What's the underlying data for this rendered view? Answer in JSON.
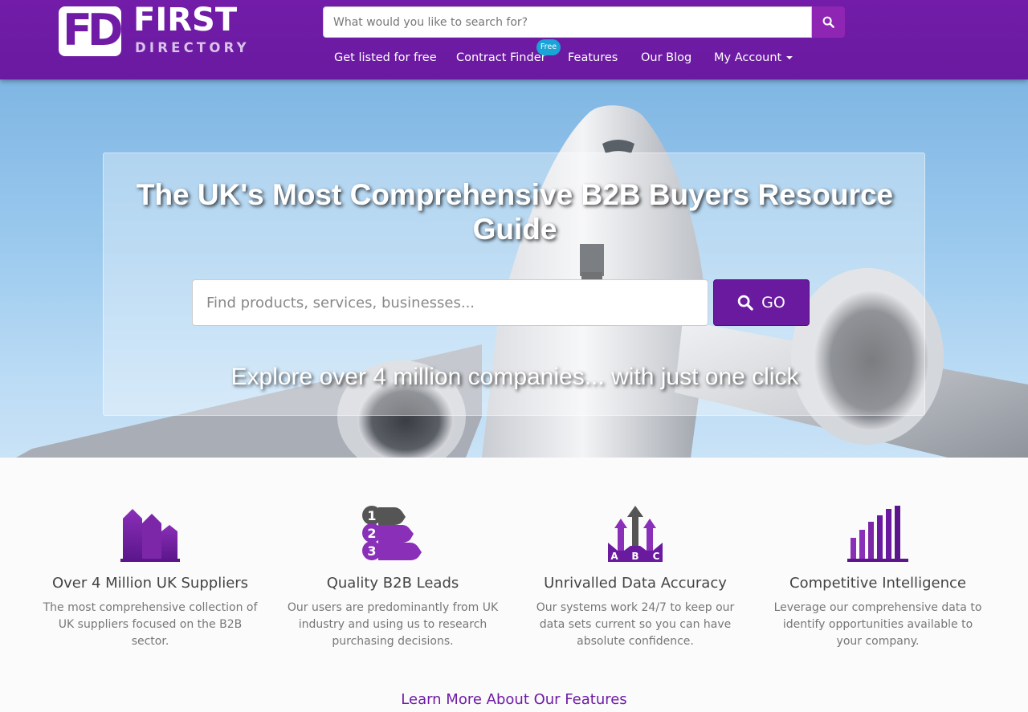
{
  "brand": {
    "logo_mark": "FD",
    "logo_word1": "FIRST",
    "logo_word2": "DIRECTORY",
    "primary_color": "#6f1ba6",
    "accent_color": "#1aa3d6"
  },
  "header": {
    "search": {
      "placeholder": "What would you like to search for?",
      "value": "",
      "icon": "search-icon"
    },
    "nav": [
      {
        "label": "Get listed for free"
      },
      {
        "label": "Contract Finder",
        "badge": "Free"
      },
      {
        "label": "Features"
      },
      {
        "label": "Our Blog"
      },
      {
        "label": "My Account",
        "icon": "caret-down-icon"
      }
    ]
  },
  "hero": {
    "title": "The UK's Most Comprehensive B2B Buyers Resource Guide",
    "search_placeholder": "Find products, services, businesses...",
    "search_value": "",
    "go_label": "GO",
    "subtitle": "Explore over 4 million companies... with just one click"
  },
  "features": [
    {
      "icon": "buildings-icon",
      "title": "Over 4 Million UK Suppliers",
      "text": "The most comprehensive collection of UK suppliers focused on the B2B sector."
    },
    {
      "icon": "numbered-list-icon",
      "title": "Quality B2B Leads",
      "text": "Our users are predominantly from UK industry and using us to research purchasing decisions."
    },
    {
      "icon": "abc-arrows-icon",
      "title": "Unrivalled Data Accuracy",
      "text": "Our systems work 24/7 to keep our data sets current so you can have absolute confidence."
    },
    {
      "icon": "bar-chart-icon",
      "title": "Competitive Intelligence",
      "text": "Leverage our comprehensive data to identify opportunities available to your company."
    }
  ],
  "learn_more": "Learn More About Our Features"
}
